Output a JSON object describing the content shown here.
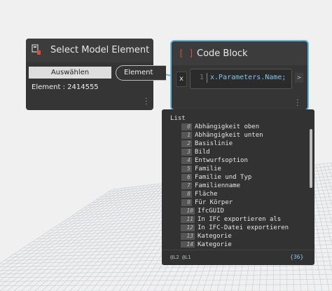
{
  "canvas": {
    "background": "#f0f0f0",
    "grid_color": "#c7ccd2"
  },
  "select_node": {
    "title": "Select Model Element",
    "select_button": "Auswählen",
    "output_port": "Element",
    "element_info": "Element : 2414555",
    "icon": "select-model-element-icon"
  },
  "code_block": {
    "title": "Code Block",
    "icon": "code-block-icon",
    "input_port": "x",
    "line_number": "1",
    "code": "x.Parameters.Name;",
    "output_port": ">",
    "accent": "#5fb6e3"
  },
  "preview": {
    "header": "List",
    "items": [
      {
        "index": "0",
        "value": "Abhängigkeit oben"
      },
      {
        "index": "1",
        "value": "Abhängigkeit unten"
      },
      {
        "index": "2",
        "value": "Basislinie"
      },
      {
        "index": "3",
        "value": "Bild"
      },
      {
        "index": "4",
        "value": "Entwurfsoption"
      },
      {
        "index": "5",
        "value": "Familie"
      },
      {
        "index": "6",
        "value": "Familie und Typ"
      },
      {
        "index": "7",
        "value": "Familienname"
      },
      {
        "index": "8",
        "value": "Fläche"
      },
      {
        "index": "9",
        "value": "Für Körper"
      },
      {
        "index": "10",
        "value": "IfcGUID"
      },
      {
        "index": "11",
        "value": "In IFC exportieren als"
      },
      {
        "index": "12",
        "value": "In IFC-Datei exportieren"
      },
      {
        "index": "13",
        "value": "Kategorie"
      },
      {
        "index": "14",
        "value": "Kategorie"
      }
    ],
    "levels": "@L2 @L1",
    "count": "{36}"
  }
}
